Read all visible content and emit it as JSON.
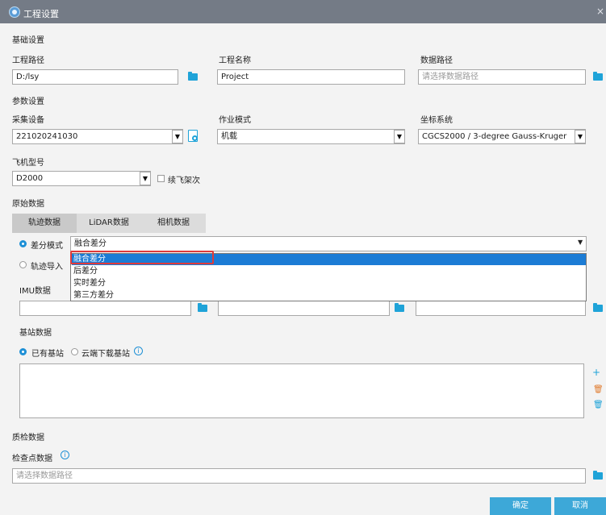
{
  "window": {
    "title": "工程设置",
    "close_glyph": "×"
  },
  "basic": {
    "section_title": "基础设置",
    "project_path_label": "工程路径",
    "project_path_value": "D:/lsy",
    "project_name_label": "工程名称",
    "project_name_value": "Project",
    "data_path_label": "数据路径",
    "data_path_placeholder": "请选择数据路径"
  },
  "params": {
    "section_title": "参数设置",
    "device_label": "采集设备",
    "device_value": "221020241030",
    "mode_label": "作业模式",
    "mode_value": "机载",
    "crs_label": "坐标系统",
    "crs_value": "CGCS2000 / 3-degree Gauss-Kruger",
    "aircraft_label": "飞机型号",
    "aircraft_value": "D2000",
    "continue_flight_label": "续飞架次",
    "continue_flight_checked": false
  },
  "raw": {
    "section_title": "原始数据",
    "tabs": [
      {
        "label": "轨迹数据",
        "active": true
      },
      {
        "label": "LiDAR数据",
        "active": false
      },
      {
        "label": "相机数据",
        "active": false
      }
    ],
    "diff_mode_label": "差分模式",
    "diff_mode_value": "融合差分",
    "diff_options": [
      "融合差分",
      "后差分",
      "实时差分",
      "第三方差分"
    ],
    "track_import_label": "轨迹导入",
    "imu_label": "IMU数据"
  },
  "base_station": {
    "section_title": "基站数据",
    "existing_label": "已有基站",
    "cloud_label": "云端下载基站",
    "selected": "existing"
  },
  "qc": {
    "section_title": "质检数据",
    "checkpoint_label": "检查点数据",
    "checkpoint_placeholder": "请选择数据路径"
  },
  "footer": {
    "ok_label": "确定",
    "cancel_label": "取消"
  },
  "colors": {
    "titlebar": "#747b86",
    "accent": "#1fa3d8",
    "selection": "#1c7cd5",
    "highlight_border": "#e03a3a",
    "button": "#3da8d8"
  },
  "icons": [
    "app-logo-icon",
    "close-icon",
    "folder-icon",
    "device-settings-icon",
    "dropdown-arrow-icon",
    "info-icon",
    "add-icon",
    "delete-icon",
    "clear-icon"
  ]
}
